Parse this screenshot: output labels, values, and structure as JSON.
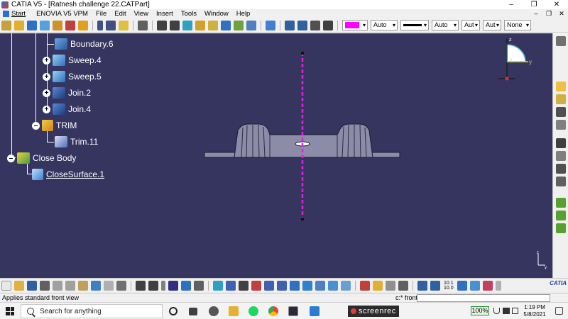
{
  "window": {
    "title": "CATIA V5 - [Ratnesh challenge 22.CATPart]",
    "controls": {
      "minimize": "–",
      "maximize": "❐",
      "close": "✕"
    }
  },
  "menubar": {
    "start": "Start",
    "items": [
      "ENOVIA V5 VPM",
      "File",
      "Edit",
      "View",
      "Insert",
      "Tools",
      "Window",
      "Help"
    ],
    "inner_controls": {
      "minimize": "–",
      "restore": "❐",
      "close": "✕"
    }
  },
  "toolbar_top": {
    "color_value": "",
    "color_swatch": "#ff00ff",
    "transparency_value": "Auto",
    "linetype_value": "",
    "thickness_value": "Auto",
    "layer_value": "Aut",
    "point_value": "Aut",
    "none_value": "None"
  },
  "tree": {
    "items": [
      {
        "label": "Boundary.6",
        "has_expander": false
      },
      {
        "label": "Sweep.4",
        "has_expander": true
      },
      {
        "label": "Sweep.5",
        "has_expander": true
      },
      {
        "label": "Join.2",
        "has_expander": true
      },
      {
        "label": "Join.4",
        "has_expander": true
      },
      {
        "label": "TRIM",
        "has_expander": true
      },
      {
        "label": "Trim.11",
        "has_expander": false
      },
      {
        "label": "Close Body",
        "has_expander": true
      },
      {
        "label": "CloseSurface.1",
        "has_expander": false
      }
    ],
    "expander_symbols": {
      "plus": "+",
      "minus": "–"
    }
  },
  "compass": {
    "axis_z": "z",
    "axis_y": "y",
    "axis_x": "x"
  },
  "mini_axis": {
    "axis_z": "z",
    "axis_y": "y"
  },
  "colors": {
    "viewport": "#353560",
    "axis_line": "#e020e0",
    "part_fill": "#8c8ca8",
    "part_edge": "#1a1a2e",
    "compass_arc": "#4ab0c8",
    "compass_y": "#d8d820",
    "compass_origin": "#e03030"
  },
  "bottom_toolbar": {
    "zoom_top": "10.1",
    "zoom_bottom": "10.0",
    "logo": "CATIA"
  },
  "status": {
    "text": "Applies standard front view",
    "command_label": "c:* front",
    "command_value": ""
  },
  "taskbar": {
    "search_placeholder": "Search for anything",
    "screenrec_label": "screenrec",
    "battery_percent": "100%",
    "time": "1:19 PM",
    "date": "5/8/2021"
  }
}
